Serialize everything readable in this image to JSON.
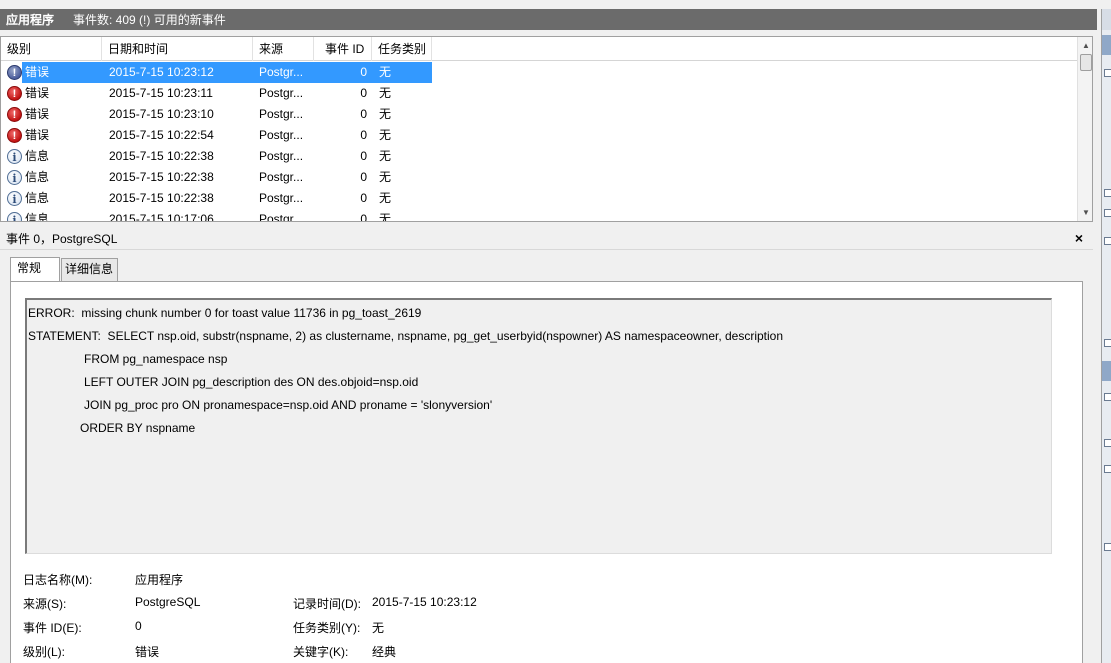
{
  "header": {
    "title": "应用程序",
    "subtitle": "事件数: 409 (!) 可用的新事件"
  },
  "columns": [
    "级别",
    "日期和时间",
    "来源",
    "事件 ID",
    "任务类别"
  ],
  "events": [
    {
      "level_icon": "error-icon",
      "level": "错误",
      "datetime": "2015-7-15 10:23:12",
      "source": "Postgr...",
      "event_id": "0",
      "task": "无",
      "selected": true
    },
    {
      "level_icon": "error-icon",
      "level": "错误",
      "datetime": "2015-7-15 10:23:11",
      "source": "Postgr...",
      "event_id": "0",
      "task": "无"
    },
    {
      "level_icon": "error-icon",
      "level": "错误",
      "datetime": "2015-7-15 10:23:10",
      "source": "Postgr...",
      "event_id": "0",
      "task": "无"
    },
    {
      "level_icon": "error-icon",
      "level": "错误",
      "datetime": "2015-7-15 10:22:54",
      "source": "Postgr...",
      "event_id": "0",
      "task": "无"
    },
    {
      "level_icon": "info-icon",
      "level": "信息",
      "datetime": "2015-7-15 10:22:38",
      "source": "Postgr...",
      "event_id": "0",
      "task": "无"
    },
    {
      "level_icon": "info-icon",
      "level": "信息",
      "datetime": "2015-7-15 10:22:38",
      "source": "Postgr...",
      "event_id": "0",
      "task": "无"
    },
    {
      "level_icon": "info-icon",
      "level": "信息",
      "datetime": "2015-7-15 10:22:38",
      "source": "Postgr...",
      "event_id": "0",
      "task": "无"
    },
    {
      "level_icon": "info-icon",
      "level": "信息",
      "datetime": "2015-7-15 10:17:06",
      "source": "Postgr...",
      "event_id": "0",
      "task": "无"
    }
  ],
  "detail": {
    "title": "事件 0，PostgreSQL",
    "close": "×",
    "tabs": [
      "常规",
      "详细信息"
    ],
    "description_lines": [
      "ERROR:  missing chunk number 0 for toast value 11736 in pg_toast_2619",
      "STATEMENT:  SELECT nsp.oid, substr(nspname, 2) as clustername, nspname, pg_get_userbyid(nspowner) AS namespaceowner, description",
      "FROM pg_namespace nsp",
      "LEFT OUTER JOIN pg_description des ON des.objoid=nsp.oid",
      "JOIN pg_proc pro ON pronamespace=nsp.oid AND proname = 'slonyversion'",
      "ORDER BY nspname"
    ],
    "props": {
      "log_name_label": "日志名称(M):",
      "log_name": "应用程序",
      "source_label": "来源(S):",
      "source": "PostgreSQL",
      "logged_label": "记录时间(D):",
      "logged": "2015-7-15 10:23:12",
      "event_id_label": "事件 ID(E):",
      "event_id": "0",
      "task_label": "任务类别(Y):",
      "task": "无",
      "level_label": "级别(L):",
      "level": "错误",
      "keywords_label": "关键字(K):",
      "keywords": "经典"
    }
  }
}
